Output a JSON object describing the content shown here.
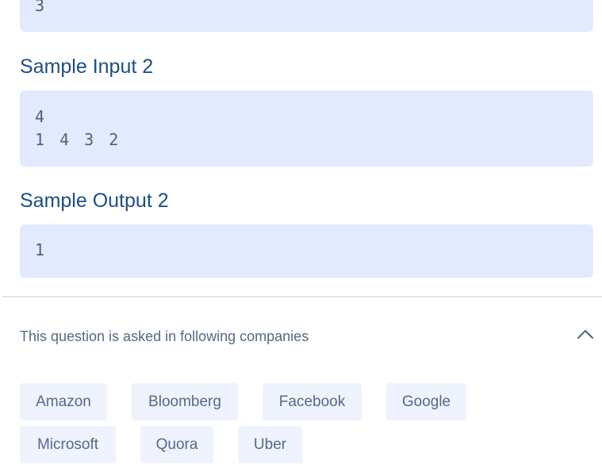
{
  "samples": {
    "input1_tail": {
      "lines": [
        "3"
      ]
    },
    "input2": {
      "title": "Sample Input 2",
      "lines": [
        "4",
        "1 4 3 2"
      ]
    },
    "output2": {
      "title": "Sample Output 2",
      "lines": [
        "1"
      ]
    }
  },
  "companies": {
    "title": "This question is asked in following companies",
    "toggle_icon": "chevron-up-icon",
    "tags": [
      "Amazon",
      "Bloomberg",
      "Facebook",
      "Google",
      "Microsoft",
      "Quora",
      "Uber"
    ]
  },
  "colors": {
    "heading": "#1c4e86",
    "code_background": "#e1eaff",
    "chip_background": "#eef3fd",
    "muted_text": "#576986"
  }
}
